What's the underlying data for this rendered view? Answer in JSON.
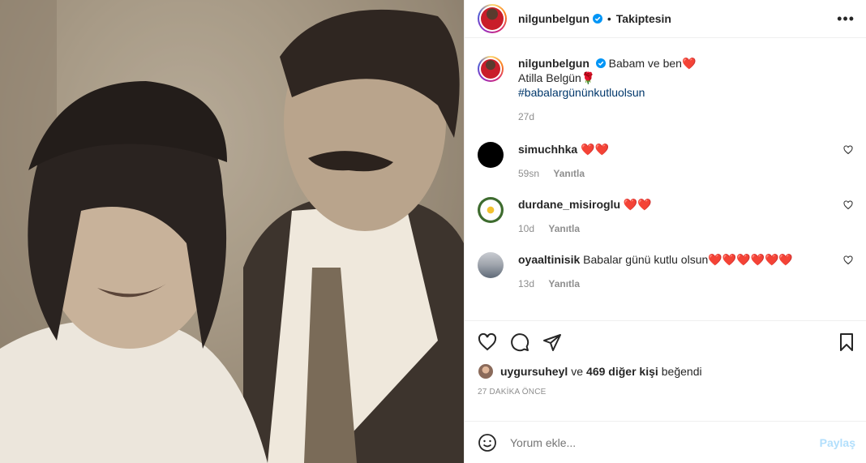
{
  "colors": {
    "link": "#00376b",
    "muted": "#8e8e8e",
    "verified": "#0095f6",
    "post_disabled": "#b2dffc",
    "heart": "#e8112d"
  },
  "media": {
    "description_icon": "photo"
  },
  "header": {
    "username": "nilgunbelgun",
    "separator": "•",
    "follow_label": "Takiptesin",
    "more_icon": "ellipsis-icon"
  },
  "caption": {
    "username": "nilgunbelgun",
    "line1": "Babam ve ben❤️",
    "line2": "Atilla Belgün🌹",
    "hashtag": "#babalargününkutluolsun",
    "time": "27d"
  },
  "comments": [
    {
      "username": "simuchhka",
      "text": "❤️❤️",
      "time": "59sn",
      "reply": "Yanıtla"
    },
    {
      "username": "durdane_misiroglu",
      "text": "❤️❤️",
      "time": "10d",
      "reply": "Yanıtla"
    },
    {
      "username": "oyaaltinisik",
      "text": "Babalar günü kutlu olsun❤️❤️❤️❤️❤️❤️",
      "time": "13d",
      "reply": "Yanıtla"
    }
  ],
  "likes": {
    "first_user": "uygursuheyl",
    "connector": "ve",
    "others": "469 diğer kişi",
    "suffix": "beğendi"
  },
  "timestamp": "27 DAKİKA ÖNCE",
  "add_comment": {
    "placeholder": "Yorum ekle...",
    "post_label": "Paylaş"
  }
}
